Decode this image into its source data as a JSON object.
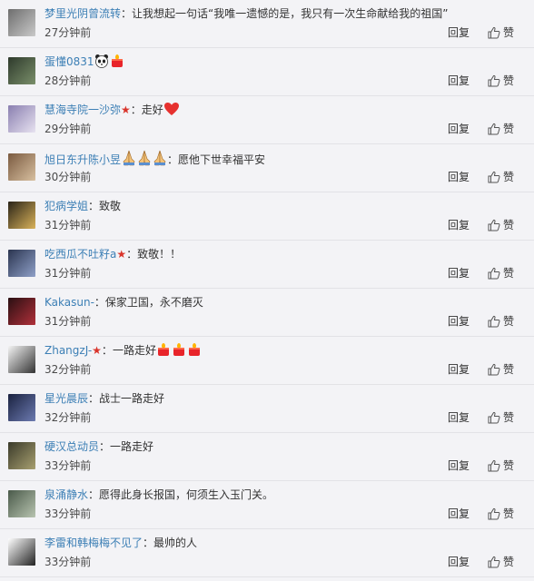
{
  "comments": [
    {
      "user": "梦里光阴曾流转",
      "sep": "：",
      "text": "让我想起一句话“我唯一遗憾的是，我只有一次生命献给我的祖国”",
      "time": "27分钟前",
      "reply": "回复",
      "like": "赞",
      "avatar_colors": [
        "#6e6e6e",
        "#c9c9c9"
      ],
      "emojis": [],
      "star": false
    },
    {
      "user": "蛋懂0831",
      "sep": "",
      "text": "",
      "time": "28分钟前",
      "reply": "回复",
      "like": "赞",
      "avatar_colors": [
        "#2e3a2c",
        "#7a8f6a"
      ],
      "emojis": [
        "panda-emoji",
        "candle-emoji"
      ],
      "star": false
    },
    {
      "user": "慧海寺院一沙弥",
      "sep": "：",
      "text": "走好",
      "time": "29分钟前",
      "reply": "回复",
      "like": "赞",
      "avatar_colors": [
        "#8a7fb0",
        "#e7e2f0"
      ],
      "emojis": [
        "heart-emoji"
      ],
      "star": true
    },
    {
      "user": "旭日东升陈小昱",
      "sep": "：",
      "text": "愿他下世幸福平安",
      "time": "30分钟前",
      "reply": "回复",
      "like": "赞",
      "avatar_colors": [
        "#7a5a40",
        "#d8c0a0"
      ],
      "emojis_before_text": [
        "pray-emoji",
        "pray-emoji",
        "pray-emoji"
      ],
      "emojis": [],
      "star": false
    },
    {
      "user": "犯病学姐",
      "sep": "：",
      "text": "致敬",
      "time": "31分钟前",
      "reply": "回复",
      "like": "赞",
      "avatar_colors": [
        "#2a2418",
        "#d9b25a"
      ],
      "emojis": [],
      "star": false
    },
    {
      "user": "吃西瓜不吐籽a",
      "sep": "：",
      "text": "致敬！！",
      "time": "31分钟前",
      "reply": "回复",
      "like": "赞",
      "avatar_colors": [
        "#2b3550",
        "#8fa0c8"
      ],
      "emojis": [],
      "star": true
    },
    {
      "user": "Kakasun-",
      "sep": "：",
      "text": "保家卫国，永不磨灭",
      "time": "31分钟前",
      "reply": "回复",
      "like": "赞",
      "avatar_colors": [
        "#2a0f12",
        "#b0303a"
      ],
      "emojis": [],
      "star": false
    },
    {
      "user": "ZhangzJ-",
      "sep": "：",
      "text": "一路走好",
      "time": "32分钟前",
      "reply": "回复",
      "like": "赞",
      "avatar_colors": [
        "#f4f4f4",
        "#333333"
      ],
      "emojis": [
        "candle-emoji",
        "candle-emoji",
        "candle-emoji"
      ],
      "star": true
    },
    {
      "user": "星光晨辰",
      "sep": "：",
      "text": "战士一路走好",
      "time": "32分钟前",
      "reply": "回复",
      "like": "赞",
      "avatar_colors": [
        "#1a2240",
        "#6c7ab0"
      ],
      "emojis": [],
      "star": false
    },
    {
      "user": "硬汉总动员",
      "sep": "：",
      "text": "一路走好",
      "time": "33分钟前",
      "reply": "回复",
      "like": "赞",
      "avatar_colors": [
        "#3a3a2a",
        "#a8a070"
      ],
      "emojis": [],
      "star": false
    },
    {
      "user": "泉涌静水",
      "sep": "：",
      "text": "愿得此身长报国，何须生入玉门关。",
      "time": "33分钟前",
      "reply": "回复",
      "like": "赞",
      "avatar_colors": [
        "#4a5a4a",
        "#b8c4b0"
      ],
      "emojis": [],
      "star": false
    },
    {
      "user": "李雷和韩梅梅不见了",
      "sep": "：",
      "text": "最帅的人",
      "time": "33分钟前",
      "reply": "回复",
      "like": "赞",
      "avatar_colors": [
        "#ffffff",
        "#222222"
      ],
      "emojis": [],
      "star": false
    }
  ],
  "colors": {
    "username": "#3c7fb5",
    "star": "#d9342b",
    "text": "#333333"
  }
}
